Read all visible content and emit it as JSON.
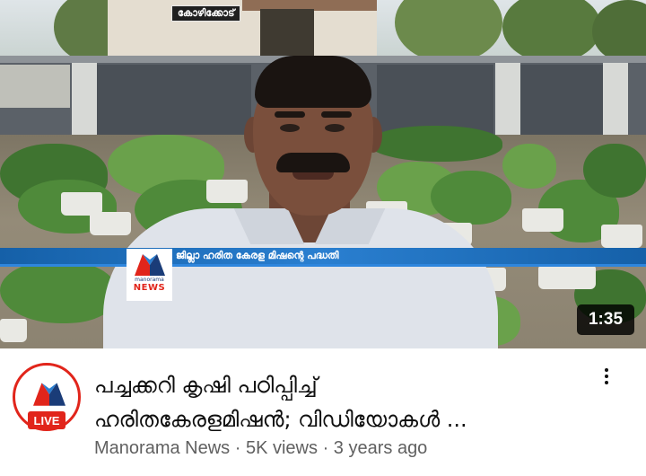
{
  "video": {
    "location_tag": "കോഴിക്കോട്",
    "ticker_text": "ജില്ലാ ഹരിത കേരള മിഷന്റെ പദ്ധതി",
    "channel_logo_small": "manorama",
    "channel_logo_news": "NEWS",
    "duration": "1:35"
  },
  "meta": {
    "title_line1": "പച്ചക്കറി കൃഷി പഠിപ്പിച്ച്",
    "title_line2": "ഹരിതകേരളമിഷൻ; വിഡിയോകൾ ...",
    "channel": "Manorama News",
    "views": "5K views",
    "age": "3 years ago",
    "separator": "·",
    "live_label": "LIVE"
  },
  "icons": {
    "menu": "more-vert-icon",
    "channel": "manorama-logo-icon"
  },
  "colors": {
    "brand_red": "#e1251b",
    "brand_blue": "#1a3c78",
    "ticker_blue": "#2a7fd0"
  }
}
